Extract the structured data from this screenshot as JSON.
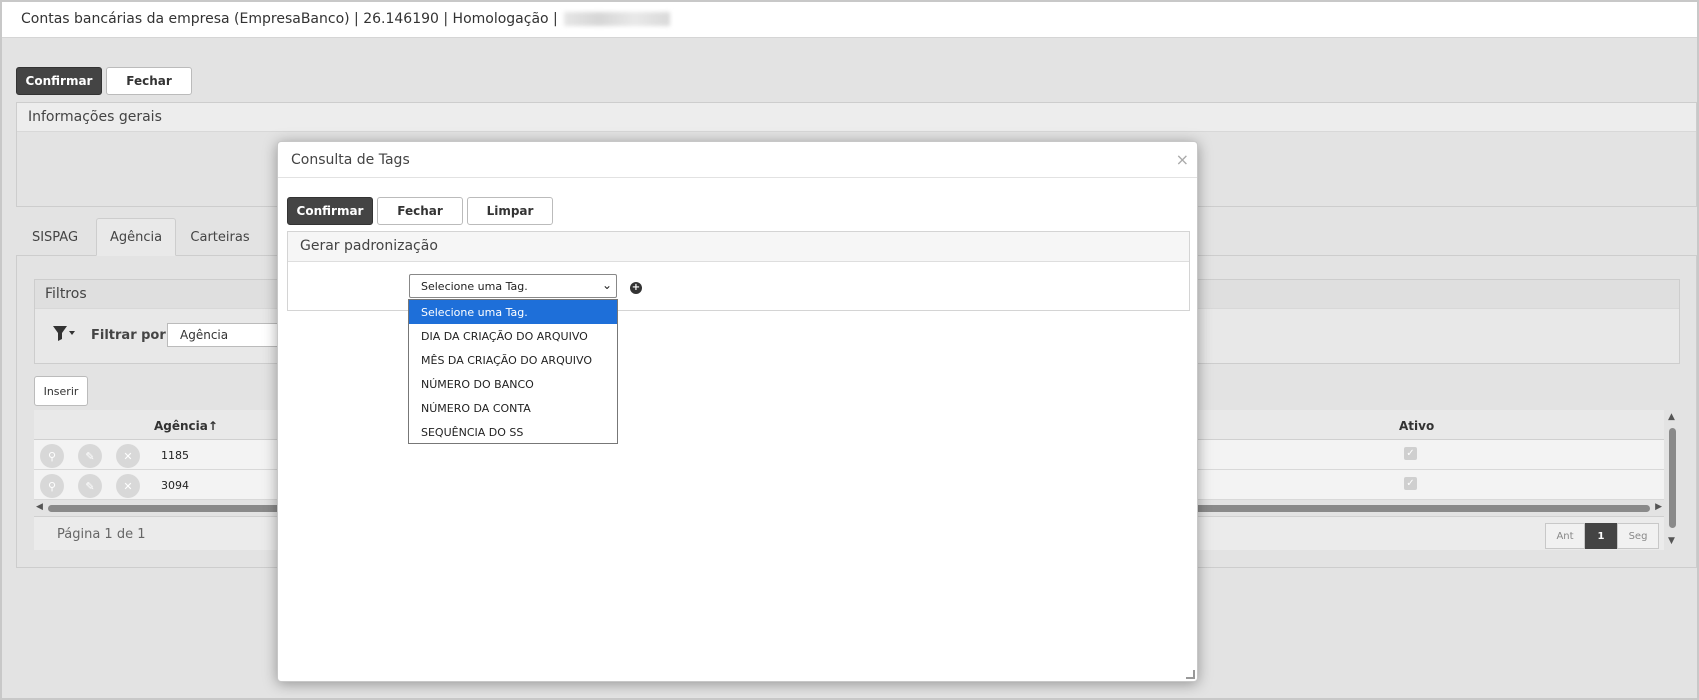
{
  "window": {
    "title": "Contas bancárias da empresa (EmpresaBanco) | 26.146190 | Homologação |"
  },
  "toolbar": {
    "confirm_label": "Confirmar",
    "close_label": "Fechar"
  },
  "general_panel": {
    "title": "Informações gerais"
  },
  "tabs": [
    {
      "label": "SISPAG"
    },
    {
      "label": "Agência"
    },
    {
      "label": "Carteiras"
    }
  ],
  "filters": {
    "title": "Filtros",
    "filter_by_label": "Filtrar por",
    "filter_value": "Agência"
  },
  "grid": {
    "insert_label": "Inserir",
    "columns": [
      "Agência",
      "Ativo"
    ],
    "sort_arrow": "↑",
    "rows": [
      {
        "agencia": "1185",
        "ativo": true
      },
      {
        "agencia": "3094",
        "ativo": true
      }
    ],
    "page_info": "Página 1 de 1",
    "pagination": {
      "prev": "Ant",
      "current": "1",
      "next": "Seg"
    }
  },
  "modal": {
    "title": "Consulta de Tags",
    "close": "×",
    "buttons": {
      "confirm": "Confirmar",
      "close": "Fechar",
      "clear": "Limpar"
    },
    "section_title": "Gerar padronização",
    "select_value": "Selecione uma Tag.",
    "options": [
      "Selecione uma Tag.",
      "DIA DA CRIAÇÃO DO ARQUIVO",
      "MÊS DA CRIAÇÃO DO ARQUIVO",
      "NÚMERO DO BANCO",
      "NÚMERO DA CONTA",
      "SEQUÊNCIA DO SS"
    ]
  }
}
